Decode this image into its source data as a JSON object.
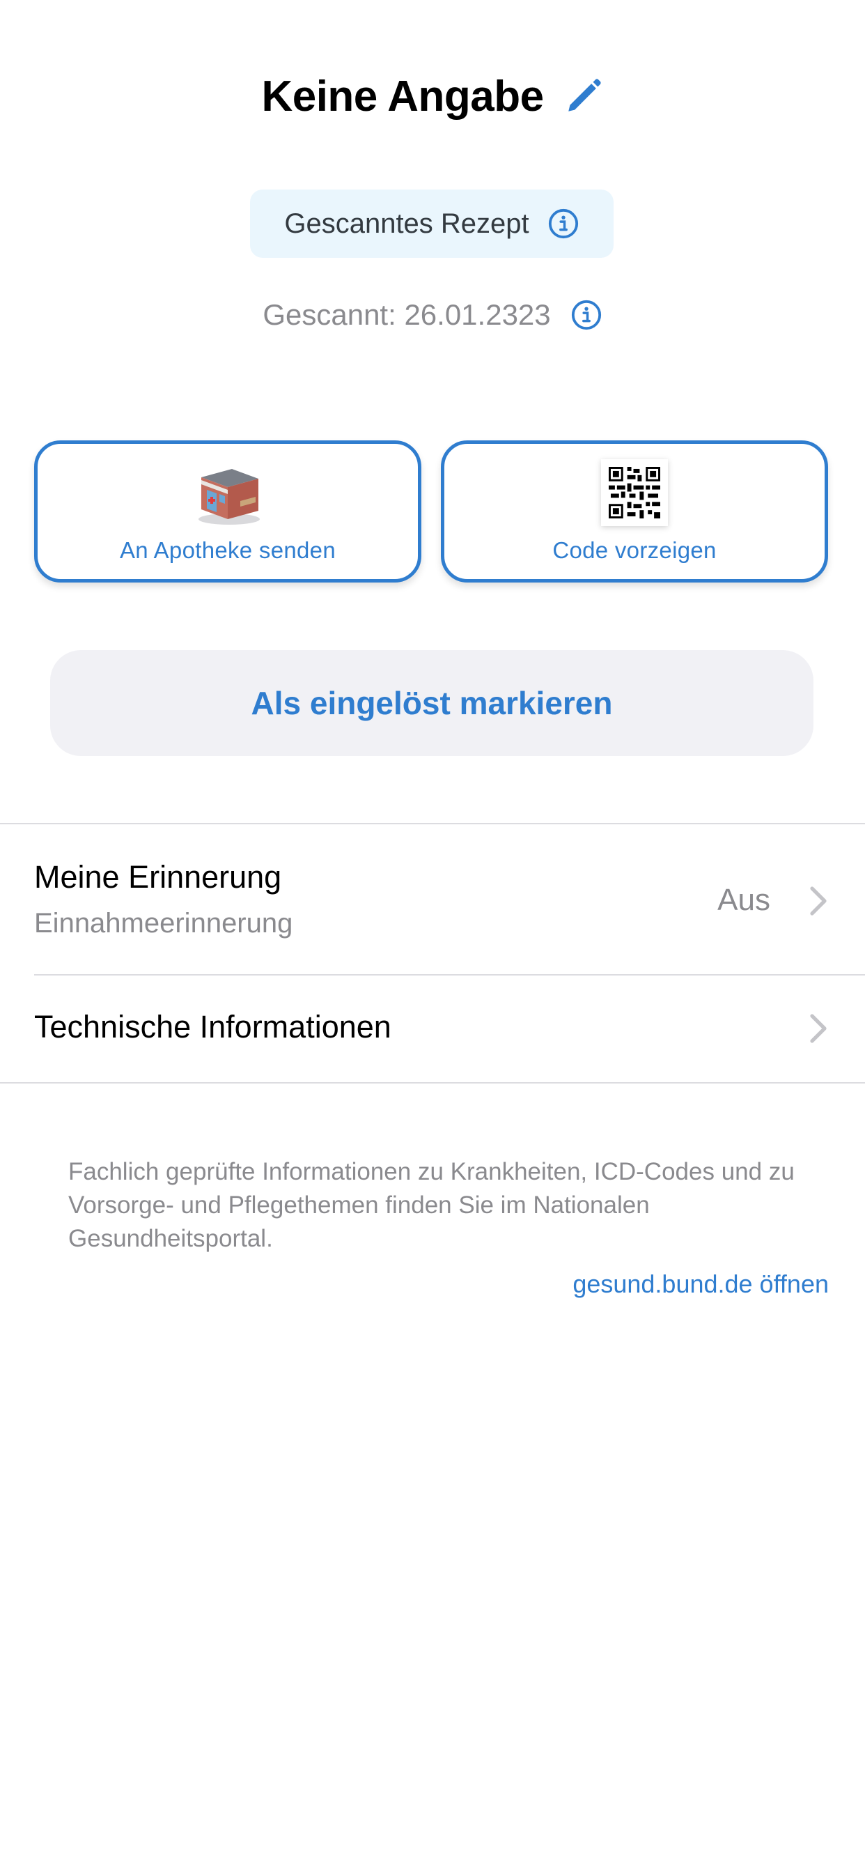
{
  "header": {
    "title": "Keine Angabe",
    "edit_icon": "pencil-icon"
  },
  "badge": {
    "label": "Gescanntes Rezept",
    "icon": "info-icon"
  },
  "scanned": {
    "label": "Gescannt: 26.01.2323",
    "icon": "info-icon"
  },
  "actions": {
    "send_to_pharmacy": {
      "label": "An Apotheke senden",
      "icon": "pharmacy-building-icon"
    },
    "show_code": {
      "label": "Code vorzeigen",
      "icon": "qr-code-icon"
    }
  },
  "redeem_button": {
    "label": "Als eingelöst markieren"
  },
  "list": {
    "reminder": {
      "title": "Meine Erinnerung",
      "subtitle": "Einnahmeerinnerung",
      "value": "Aus"
    },
    "technical": {
      "title": "Technische Informationen"
    }
  },
  "footer": {
    "text": "Fachlich geprüfte Informationen zu Krankheiten, ICD-Codes und zu Vorsorge- und Pflegethemen finden Sie im Nationalen Gesundheitsportal.",
    "link": "gesund.bund.de öffnen"
  },
  "colors": {
    "accent": "#2f7dcf",
    "badge_bg": "#eaf6fd",
    "button_bg": "#f1f1f5",
    "secondary_text": "#8a8a8e"
  }
}
